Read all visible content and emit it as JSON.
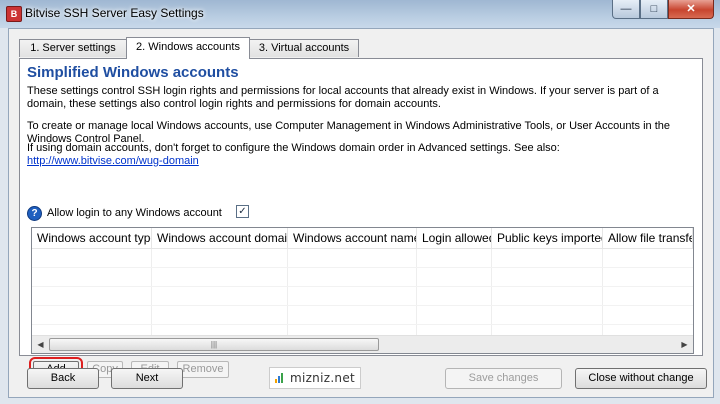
{
  "window": {
    "app_icon": "B",
    "title": "Bitvise SSH Server Easy Settings",
    "minimize": "—",
    "maximize": "□",
    "close": "✕"
  },
  "tabs": [
    {
      "label": "1. Server settings",
      "active": false
    },
    {
      "label": "2. Windows accounts",
      "active": true
    },
    {
      "label": "3. Virtual accounts",
      "active": false
    }
  ],
  "section": {
    "heading": "Simplified Windows accounts",
    "para1": "These settings control SSH login rights and permissions for local accounts that already exist in Windows. If your server is part of a domain, these settings also control login rights and permissions for domain accounts.",
    "para2": "To create or manage local Windows accounts, use Computer Management in Windows Administrative Tools, or User Accounts in the Windows Control Panel.",
    "para3_prefix": "If using domain accounts, don't forget to configure the Windows domain order in Advanced settings. See also: ",
    "para3_link": "http://www.bitvise.com/wug-domain"
  },
  "allow_login": {
    "help_icon": "?",
    "label": "Allow login to any Windows account",
    "checked": true,
    "check_glyph": "✓"
  },
  "table": {
    "columns": [
      "Windows account type",
      "Windows account domain",
      "Windows account name",
      "Login allowed",
      "Public keys imported",
      "Allow file transfer"
    ],
    "rows": [],
    "scroll_left": "◀",
    "scroll_right": "▶",
    "scroll_grip": "|||"
  },
  "list_actions": {
    "add": "Add",
    "copy": "Copy",
    "edit": "Edit",
    "remove": "Remove"
  },
  "footer": {
    "back": "Back",
    "next": "Next",
    "brand": "mizniz.net",
    "save": "Save changes",
    "close": "Close without change"
  },
  "colors": {
    "heading": "#1f4ea1",
    "highlight": "#dd1f1f"
  }
}
